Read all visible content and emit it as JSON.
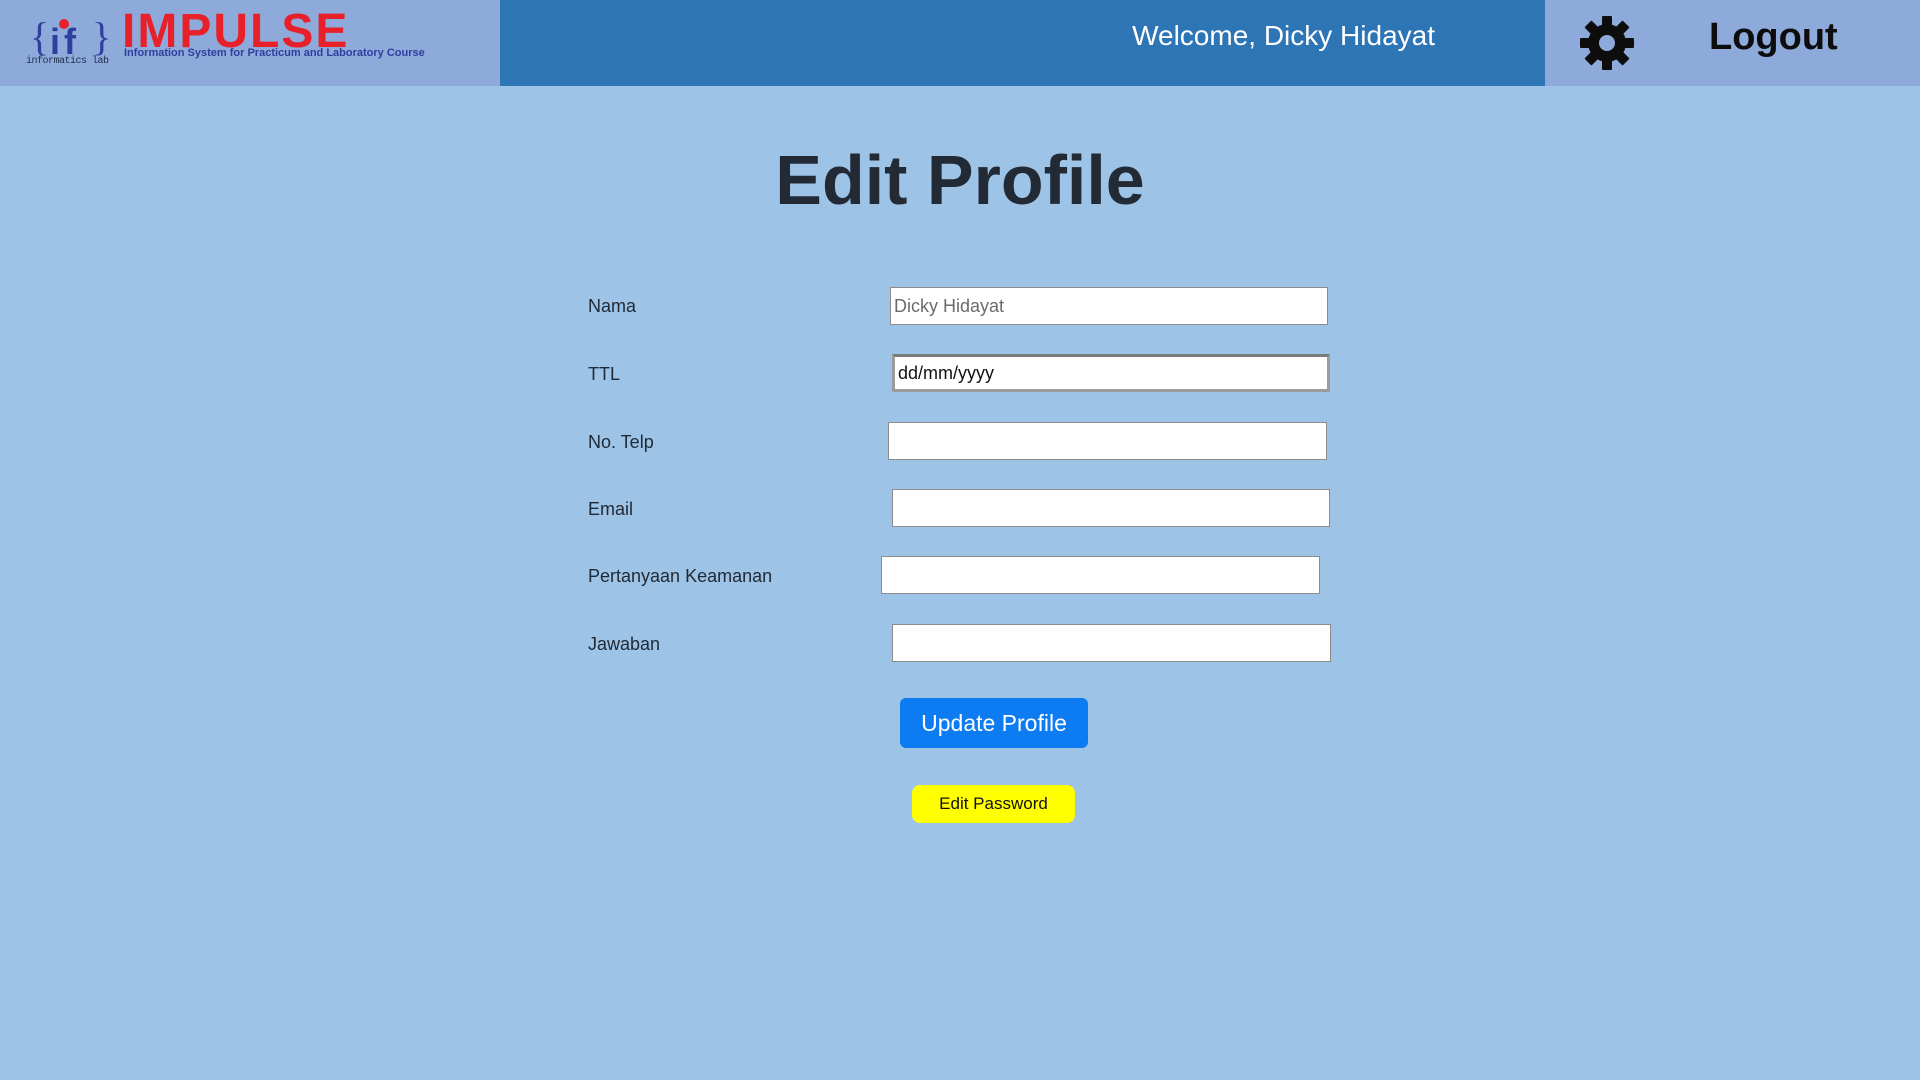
{
  "header": {
    "logo_sub": "informatics lab",
    "brand_name": "IMPULSE",
    "brand_tagline": "Information System for Practicum and Laboratory Course",
    "welcome": "Welcome, Dicky Hidayat",
    "settings_icon": "gear-icon",
    "logout_label": "Logout"
  },
  "page": {
    "title": "Edit Profile"
  },
  "form": {
    "fields": [
      {
        "label": "Nama",
        "value": "",
        "placeholder": "Dicky Hidayat"
      },
      {
        "label": "TTL",
        "value": "dd/mm/yyyy",
        "placeholder": ""
      },
      {
        "label": "No. Telp",
        "value": "",
        "placeholder": ""
      },
      {
        "label": "Email",
        "value": "",
        "placeholder": ""
      },
      {
        "label": "Pertanyaan Keamanan",
        "value": "",
        "placeholder": ""
      },
      {
        "label": "Jawaban",
        "value": "",
        "placeholder": ""
      }
    ],
    "update_label": "Update Profile",
    "password_label": "Edit Password"
  },
  "colors": {
    "background": "#9dc3e6",
    "header_bar": "#2e75b6",
    "brand_panel": "#8eaadb",
    "brand_red": "#e8202a",
    "update_button": "#0d7cf2",
    "password_button": "#ffff00"
  }
}
